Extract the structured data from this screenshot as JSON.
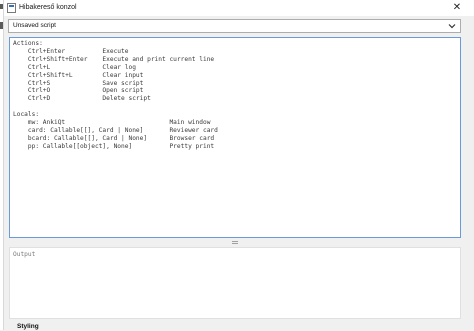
{
  "window": {
    "title": "Hibakereső konzol",
    "close_glyph": "✕"
  },
  "script_selector": {
    "selected": "Unsaved script"
  },
  "script_editor": {
    "content": "Actions:\n    Ctrl+Enter          Execute\n    Ctrl+Shift+Enter    Execute and print current line\n    Ctrl+L              Clear log\n    Ctrl+Shift+L        Clear input\n    Ctrl+S              Save script\n    Ctrl+O              Open script\n    Ctrl+D              Delete script\n\nLocals:\n    mw: AnkiQt                            Main window\n    card: Callable[[], Card | None]       Reviewer card\n    bcard: Callable[[], Card | None]      Browser card\n    pp: Callable[[object], None]          Pretty print"
  },
  "output": {
    "placeholder": "Output"
  },
  "footer": {
    "label": "Styling"
  },
  "icons": {
    "app": "app-icon",
    "close": "close-icon",
    "dropdown": "chevron-down-icon",
    "splitter": "splitter-grip-icon"
  }
}
